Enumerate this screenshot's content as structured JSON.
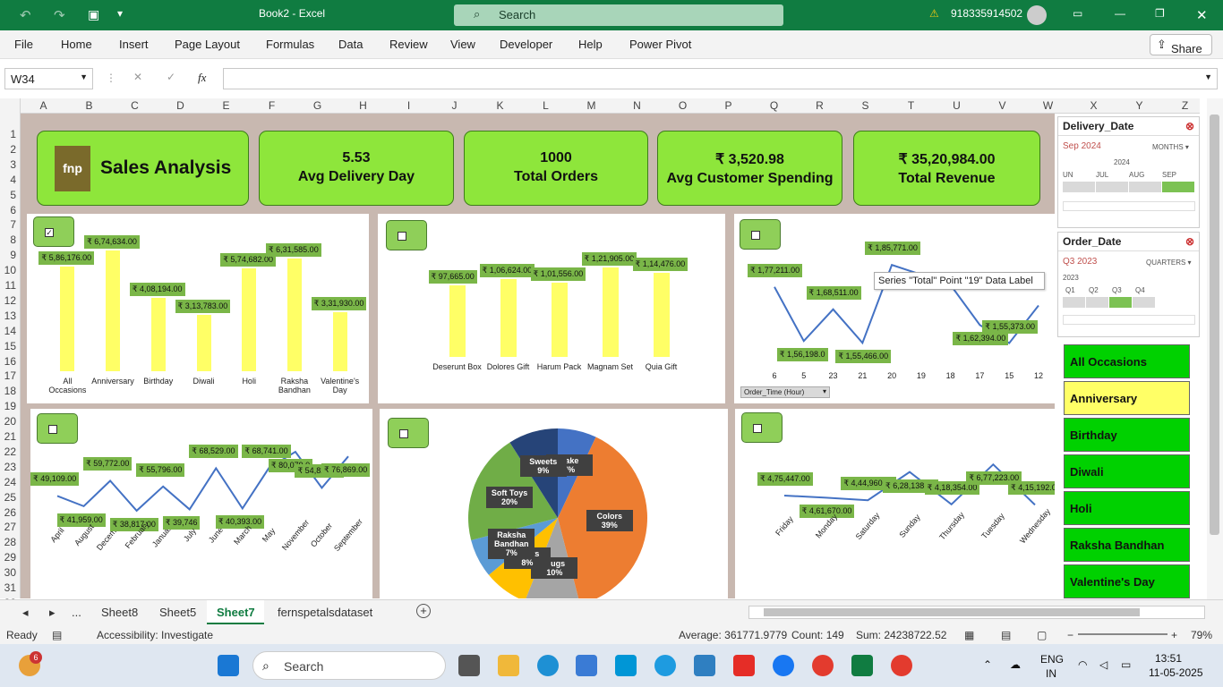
{
  "titlebar": {
    "doc_title": "Book2 - Excel",
    "search_placeholder": "Search",
    "phone": "918335914502"
  },
  "ribbon_tabs": [
    "File",
    "Home",
    "Insert",
    "Page Layout",
    "Formulas",
    "Data",
    "Review",
    "View",
    "Developer",
    "Help",
    "Power Pivot"
  ],
  "share_label": "Share",
  "formula_bar": {
    "name_box": "W34",
    "fx": "fx"
  },
  "columns": [
    "A",
    "B",
    "C",
    "D",
    "E",
    "F",
    "G",
    "H",
    "I",
    "J",
    "K",
    "L",
    "M",
    "N",
    "O",
    "P",
    "Q",
    "R",
    "S",
    "T",
    "U",
    "V",
    "W",
    "X",
    "Y",
    "Z"
  ],
  "rows": [
    "1",
    "2",
    "3",
    "4",
    "5",
    "6",
    "7",
    "8",
    "9",
    "10",
    "11",
    "12",
    "13",
    "14",
    "15",
    "16",
    "17",
    "18",
    "19",
    "20",
    "21",
    "22",
    "23",
    "24",
    "25",
    "26",
    "27",
    "28",
    "29",
    "30",
    "31",
    "32"
  ],
  "kpis": {
    "title": "Sales Analysis",
    "logo_text": "fnp",
    "delivery_value": "5.53",
    "delivery_label": "Avg Delivery Day",
    "orders_value": "1000",
    "orders_label": "Total Orders",
    "spending_value": "₹ 3,520.98",
    "spending_label": "Avg Customer Spending",
    "revenue_value": "₹ 35,20,984.00",
    "revenue_label": "Total Revenue"
  },
  "tooltip": "Series \"Total\" Point \"19\" Data Label",
  "pivot_field_button": "Order_Time (Hour)",
  "colors": {
    "excel_green": "#107c41",
    "kpi_green": "#8ee63b",
    "bar_yellow": "#ffff66",
    "label_green": "#7ab648",
    "line_blue": "#4472c4",
    "occasion_green": "#00d100",
    "occasion_selected": "#ffff66"
  },
  "chart_data": [
    {
      "type": "bar",
      "categories": [
        "All Occasions",
        "Anniversary",
        "Birthday",
        "Diwali",
        "Holi",
        "Raksha Bandhan",
        "Valentine's Day"
      ],
      "values": [
        586176,
        674634,
        408194,
        313783,
        574682,
        631585,
        331930
      ],
      "labels": [
        "₹ 5,86,176.00",
        "₹ 6,74,634.00",
        "₹ 4,08,194.00",
        "₹ 3,13,783.00",
        "₹ 5,74,682.00",
        "₹ 6,31,585.00",
        "₹ 3,31,930.00"
      ],
      "checkbox_checked": true
    },
    {
      "type": "bar",
      "categories": [
        "Deserunt Box",
        "Dolores Gift",
        "Harum Pack",
        "Magnam Set",
        "Quia Gift"
      ],
      "values": [
        97665,
        106624,
        101556,
        121905,
        114476
      ],
      "labels": [
        "₹ 97,665.00",
        "₹ 1,06,624.00",
        "₹ 1,01,556.00",
        "₹ 1,21,905.00",
        "₹ 1,14,476.00"
      ],
      "checkbox_checked": false
    },
    {
      "type": "line",
      "categories": [
        "6",
        "5",
        "23",
        "21",
        "20",
        "19",
        "18",
        "17",
        "15",
        "12"
      ],
      "values": [
        177211,
        156198,
        168511,
        155466,
        185771,
        182000,
        178000,
        162394,
        155373,
        170000
      ],
      "labels": [
        "₹ 1,77,211.00",
        "₹ 1,56,198.0",
        "₹ 1,68,511.00",
        "₹ 1,55,466.00",
        "₹ 1,85,771.00",
        "",
        "",
        "₹ 1,62,394.00",
        "₹ 1,55,373.00",
        ""
      ],
      "checkbox_checked": false
    },
    {
      "type": "line",
      "categories": [
        "April",
        "August",
        "December",
        "February",
        "January",
        "July",
        "June",
        "March",
        "May",
        "November",
        "October",
        "September"
      ],
      "values": [
        49109,
        41959,
        59772,
        38817,
        55796,
        39746,
        68529,
        40393,
        68741,
        80079,
        54824,
        76869
      ],
      "labels": [
        "₹ 49,109.00",
        "₹ 41,959.00",
        "₹ 59,772.00",
        "₹ 38,817.00",
        "₹ 55,796.00",
        "₹ 39,746",
        "₹ 68,529.00",
        "₹ 40,393.00",
        "₹ 68,741.00",
        "₹ 80,079.0",
        "₹ 54,824.00",
        "₹ 76,869.00"
      ],
      "checkbox_checked": false
    },
    {
      "type": "pie",
      "slices": [
        {
          "name": "Colors",
          "pct": "39%",
          "value": 39,
          "color": "#ed7d31"
        },
        {
          "name": "Mugs",
          "pct": "10%",
          "value": 10,
          "color": "#a5a5a5"
        },
        {
          "name": "Plants",
          "pct": "8%",
          "value": 8,
          "color": "#ffc000"
        },
        {
          "name": "Raksha Bandhan",
          "pct": "7%",
          "value": 7,
          "color": "#5b9bd5"
        },
        {
          "name": "Soft Toys",
          "pct": "20%",
          "value": 20,
          "color": "#70ad47"
        },
        {
          "name": "Sweets",
          "pct": "9%",
          "value": 9,
          "color": "#264478"
        },
        {
          "name": "Cake",
          "pct": "7%",
          "value": 7,
          "color": "#4472c4"
        }
      ],
      "checkbox_checked": false
    },
    {
      "type": "line",
      "categories": [
        "Friday",
        "Monday",
        "Saturday",
        "Sunday",
        "Thursday",
        "Tuesday",
        "Wednesday"
      ],
      "values": [
        475447,
        461670,
        444960,
        628138,
        418354,
        677223,
        415192
      ],
      "labels": [
        "₹ 4,75,447.00",
        "₹ 4,61,670.00",
        "₹ 4,44,960.00",
        "₹ 6,28,138.00",
        "₹ 4,18,354.00",
        "₹ 6,77,223.00",
        "₹ 4,15,192.00"
      ],
      "checkbox_checked": false
    }
  ],
  "slicer_delivery": {
    "title": "Delivery_Date",
    "selection": "Sep 2024",
    "level": "MONTHS",
    "year": "2024",
    "months": [
      "UN",
      "JUL",
      "AUG",
      "SEP"
    ]
  },
  "slicer_order": {
    "title": "Order_Date",
    "selection": "Q3 2023",
    "level": "QUARTERS",
    "year": "2023",
    "quarters": [
      "Q1",
      "Q2",
      "Q3",
      "Q4"
    ]
  },
  "occasions": [
    "All Occasions",
    "Anniversary",
    "Birthday",
    "Diwali",
    "Holi",
    "Raksha Bandhan",
    "Valentine's Day"
  ],
  "occasion_selected": "Anniversary",
  "sheet_tabs": [
    "...",
    "Sheet8",
    "Sheet5",
    "Sheet7",
    "fernspetalsdataset"
  ],
  "active_sheet": "Sheet7",
  "status": {
    "ready": "Ready",
    "accessibility": "Accessibility: Investigate",
    "average": "Average: 361771.9779",
    "count": "Count: 149",
    "sum": "Sum: 24238722.52",
    "zoom": "79%"
  },
  "taskbar": {
    "search": "Search",
    "lang1": "ENG",
    "lang2": "IN",
    "time": "13:51",
    "date": "11-05-2025",
    "badge": "6"
  }
}
